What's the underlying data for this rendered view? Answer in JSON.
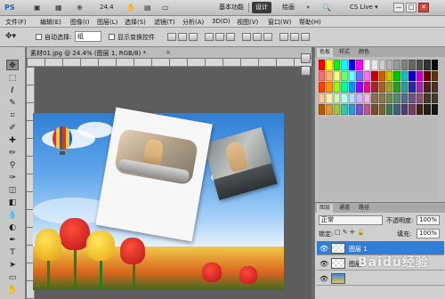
{
  "titlebar": {
    "logo": "PS",
    "zoom": "24.4",
    "workspace_buttons": [
      "基本功能",
      "设计",
      "绘画"
    ],
    "active_workspace": "设计",
    "more": "»",
    "cs_live": "CS Live ▾",
    "win_buttons": [
      "—",
      "□",
      "✕"
    ]
  },
  "menubar": {
    "items": [
      "文件(F)",
      "编辑(E)",
      "图像(I)",
      "图层(L)",
      "选择(S)",
      "滤镜(T)",
      "分析(A)",
      "3D(D)",
      "视图(V)",
      "窗口(W)",
      "帮助(H)"
    ]
  },
  "options": {
    "auto_select_label": "自动选择:",
    "auto_select_value": "组",
    "show_transform_label": "显示变换控件"
  },
  "document": {
    "tab_label": "素材01.jpg @ 24.4% (图层 1, RGB/8) *",
    "close": "×"
  },
  "swatches_panel": {
    "tabs": [
      "色板",
      "样式",
      "颜色"
    ],
    "active_tab": "色板",
    "colors": [
      "#ff0000",
      "#ffff00",
      "#00ff00",
      "#00ffff",
      "#0000ff",
      "#ff00ff",
      "#ffffff",
      "#e6e6e6",
      "#cccccc",
      "#b3b3b3",
      "#999999",
      "#808080",
      "#666666",
      "#4d4d4d",
      "#333333",
      "#000000",
      "#ff6e6e",
      "#ffb46e",
      "#ffff6e",
      "#6eff6e",
      "#6effff",
      "#6e6eff",
      "#ff6eff",
      "#c80000",
      "#c86400",
      "#c8c800",
      "#00c800",
      "#00c8c8",
      "#0000c8",
      "#c800c8",
      "#640000",
      "#643200",
      "#ff3c00",
      "#ff9600",
      "#96ff00",
      "#00ff96",
      "#0096ff",
      "#9600ff",
      "#ff0096",
      "#a02828",
      "#a06428",
      "#a0a028",
      "#28a028",
      "#28a0a0",
      "#2828a0",
      "#a028a0",
      "#502020",
      "#503220",
      "#ffc896",
      "#fff0b4",
      "#c8ffb4",
      "#b4fff0",
      "#b4dcff",
      "#d2b4ff",
      "#ffb4e6",
      "#8c6e50",
      "#8c7850",
      "#6e8c50",
      "#508c6e",
      "#506e8c",
      "#6e508c",
      "#8c506e",
      "#463728",
      "#463c28",
      "#b45a00",
      "#dc9632",
      "#a0c832",
      "#32c8a0",
      "#3296dc",
      "#7850c8",
      "#c85096",
      "#785028",
      "#78643c",
      "#3c7850",
      "#3c6478",
      "#503c78",
      "#783c64",
      "#3c2814",
      "#281e14",
      "#141414"
    ]
  },
  "layers_panel": {
    "tabs": [
      "图层",
      "通道",
      "路径"
    ],
    "active_tab": "图层",
    "blend_mode": "正常",
    "opacity_label": "不透明度:",
    "opacity_value": "100%",
    "lock_label": "锁定:",
    "lock_icons": "□ ✎ ✛ 🔒",
    "fill_label": "填充:",
    "fill_value": "100%",
    "layers": [
      {
        "name": "图层 1",
        "selected": true
      },
      {
        "name": "图层",
        "selected": false
      },
      {
        "name": "",
        "selected": false
      }
    ]
  },
  "watermark": "Baidu经验",
  "icons": {
    "move": "move-icon",
    "marquee": "marquee-icon",
    "lasso": "lasso-icon"
  }
}
